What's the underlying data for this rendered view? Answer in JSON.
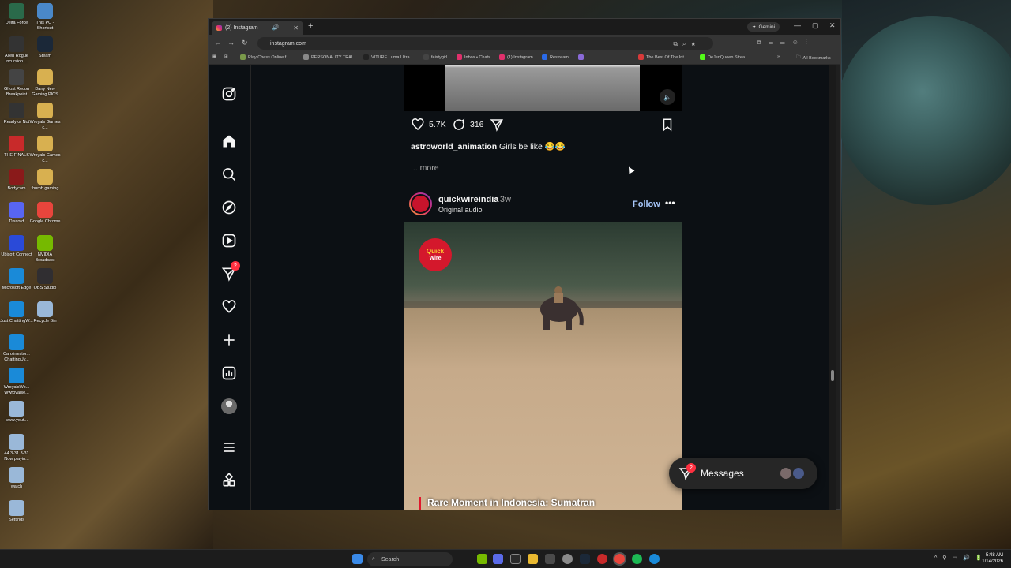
{
  "desktop": {
    "icons": [
      {
        "label": "Delta Force",
        "color": "#2a6a4a"
      },
      {
        "label": "This PC - Shortcut",
        "color": "#4a88c8"
      },
      {
        "label": "Allen Rogue Incursion ...",
        "color": "#333"
      },
      {
        "label": "Steam",
        "color": "#1b2838"
      },
      {
        "label": "Ghost Recon Breakpoint",
        "color": "#444"
      },
      {
        "label": "Dany New Gaming PICS",
        "color": "#d8b050"
      },
      {
        "label": "Ready or Not",
        "color": "#333"
      },
      {
        "label": "Wroyals Games c...",
        "color": "#d8b050"
      },
      {
        "label": "THE FINALS",
        "color": "#c82a2a"
      },
      {
        "label": "Wroyals Games c...",
        "color": "#d8b050"
      },
      {
        "label": "Bodycam",
        "color": "#8a1a1a"
      },
      {
        "label": "thumb gaming",
        "color": "#d8b050"
      },
      {
        "label": "Discord",
        "color": "#5865f2"
      },
      {
        "label": "Google Chrome",
        "color": "#e8453c"
      },
      {
        "label": "Ubisoft Connect",
        "color": "#2a4ad8"
      },
      {
        "label": "NVIDIA Broadcast",
        "color": "#76b900"
      },
      {
        "label": "Microsoft Edge",
        "color": "#1a8ad8"
      },
      {
        "label": "OBS Studio",
        "color": "#302e31"
      },
      {
        "label": "Just ChattingW...",
        "color": "#1a8ad8"
      },
      {
        "label": "Recycle Bin",
        "color": "#9ab8d8"
      },
      {
        "label": "Carolinestor... ChattingUv...",
        "color": "#1a8ad8"
      },
      {
        "label": "WroyalsWo... Wwroyalse...",
        "color": "#1a8ad8"
      },
      {
        "label": "www.yout...",
        "color": "#9ab8d8"
      },
      {
        "label": "44 3-31 3-31 Now playin...",
        "color": "#9ab8d8"
      },
      {
        "label": "watch",
        "color": "#9ab8d8"
      },
      {
        "label": "Settings",
        "color": "#9ab8d8"
      }
    ]
  },
  "browser": {
    "tab_title": "(2) Instagram",
    "new_tab": "+",
    "gemini_label": "Gemini",
    "url": "instagram.com",
    "bookmarks": [
      {
        "label": "Play Chess Online f...",
        "color": "#7a9a4a"
      },
      {
        "label": "PERSONALITY TRAI...",
        "color": "#888"
      },
      {
        "label": "VITURE Luma Ultra...",
        "color": "#222"
      },
      {
        "label": "feistygirl",
        "color": "#444"
      },
      {
        "label": "Inbox • Chats",
        "color": "#e1306c"
      },
      {
        "label": "(1) Instagram",
        "color": "#e1306c"
      },
      {
        "label": "Restream",
        "color": "#2a6ae8"
      },
      {
        "label": "...",
        "color": "#8a6ad8"
      },
      {
        "label": "The Best Of The Int...",
        "color": "#d83a3a"
      },
      {
        "label": "DeJenQueen Strea...",
        "color": "#53fc18"
      }
    ],
    "all_bookmarks": "All Bookmarks"
  },
  "instagram": {
    "nav_badge": "2",
    "prev_post": {
      "likes": "5.7K",
      "comments": "316",
      "caption_user": "astroworld_animation",
      "caption_text": "Girls be like 😂😂",
      "more": "... more"
    },
    "post": {
      "username": "quickwireindia",
      "time": "• 3w",
      "audio": "Original audio",
      "follow": "Follow",
      "logo_text_1": "Quick",
      "logo_text_2": "Wire",
      "video_title": "Rare Moment in Indonesia: Sumatran"
    },
    "messages": {
      "label": "Messages",
      "badge": "2"
    }
  },
  "taskbar": {
    "search_placeholder": "Search",
    "time": "5:48 AM",
    "date": "1/14/2026"
  }
}
